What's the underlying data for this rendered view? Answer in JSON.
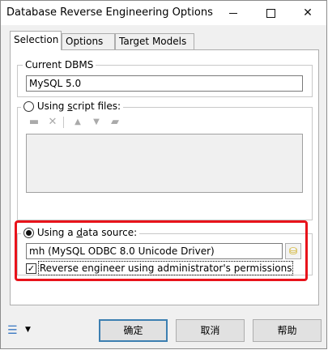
{
  "window": {
    "title": "Database Reverse Engineering Options"
  },
  "titlebar": {
    "minimize_glyph": "",
    "maximize_glyph": "",
    "close_glyph": "✕"
  },
  "tabs": [
    {
      "label": "Selection",
      "active": true
    },
    {
      "label": "Options",
      "active": false
    },
    {
      "label": "Target Models",
      "active": false
    }
  ],
  "current_dbms": {
    "legend": "Current DBMS",
    "value": "MySQL 5.0"
  },
  "script_files": {
    "radio_label_pre": "Using ",
    "radio_label_ul": "s",
    "radio_label_post": "cript files:",
    "selected": false,
    "toolbar_icons": [
      "add-file-icon",
      "delete-icon",
      "move-up-icon",
      "move-down-icon",
      "edit-icon"
    ]
  },
  "data_source": {
    "radio_label_pre": "Using a ",
    "radio_label_ul": "d",
    "radio_label_post": "ata source:",
    "selected": true,
    "value": "mh (MySQL ODBC 8.0 Unicode Driver)",
    "admin_checkbox_label": "Reverse engineer using administrator's permissions",
    "admin_checked": true,
    "highlight_color": "#e8131b"
  },
  "buttons": {
    "ok": "确定",
    "cancel": "取消",
    "help": "帮助"
  },
  "bottom": {
    "menu_icon": "options-menu-icon",
    "arrow": "▼"
  }
}
